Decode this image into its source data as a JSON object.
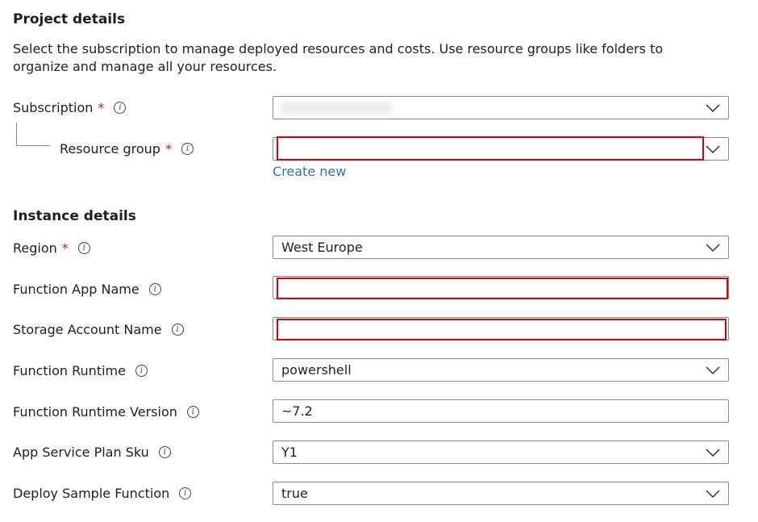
{
  "project": {
    "heading": "Project details",
    "description": "Select the subscription to manage deployed resources and costs. Use resource groups like folders to organize and manage all your resources."
  },
  "subscription": {
    "label": "Subscription",
    "required_mark": "*",
    "value": ""
  },
  "resource_group": {
    "label": "Resource group",
    "required_mark": "*",
    "value": "",
    "create_new": "Create new"
  },
  "instance": {
    "heading": "Instance details"
  },
  "fields": {
    "region": {
      "label": "Region",
      "required_mark": "*",
      "value": "West Europe"
    },
    "function_app_name": {
      "label": "Function App Name",
      "value": ""
    },
    "storage_account_name": {
      "label": "Storage Account Name",
      "value": ""
    },
    "function_runtime": {
      "label": "Function Runtime",
      "value": "powershell"
    },
    "function_runtime_version": {
      "label": "Function Runtime Version",
      "value": "~7.2"
    },
    "app_service_plan_sku": {
      "label": "App Service Plan Sku",
      "value": "Y1"
    },
    "deploy_sample_function": {
      "label": "Deploy Sample Function",
      "value": "true"
    }
  },
  "icons": {
    "info": "info-icon",
    "dropdown": "chevron-down-icon"
  },
  "colors": {
    "required": "#a4262c",
    "highlight": "#e00000",
    "link": "#3a6cc0",
    "border": "#8a8a8a"
  }
}
